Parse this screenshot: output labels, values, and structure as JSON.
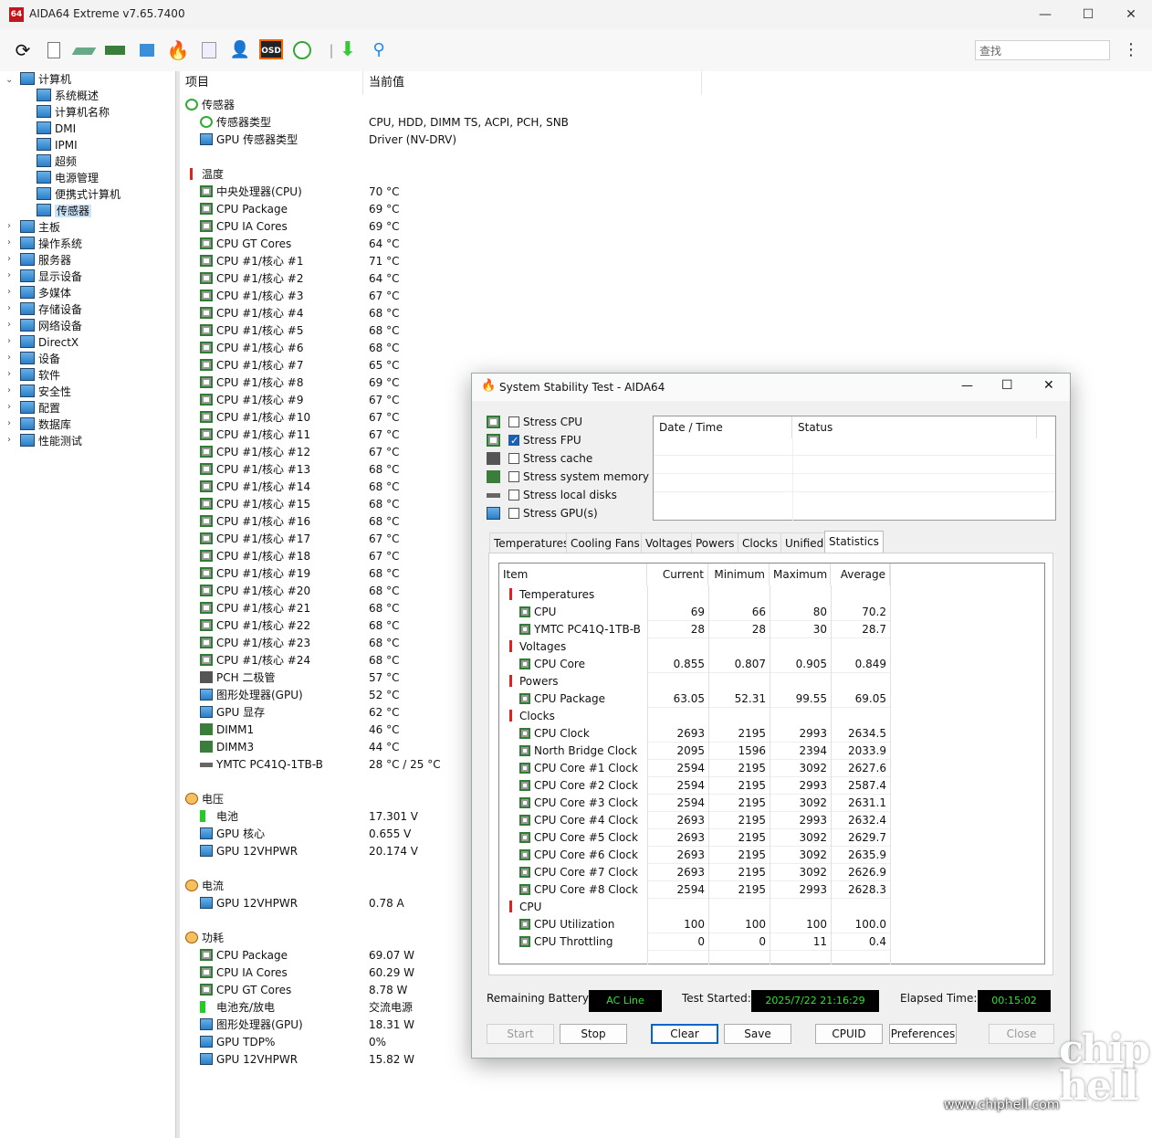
{
  "window": {
    "title": "AIDA64 Extreme v7.65.7400",
    "icon_label": "64",
    "min": "—",
    "max": "☐",
    "close": "✕"
  },
  "toolbar": {
    "osd_label": "OSD",
    "search_placeholder": "查找",
    "kebab": "⋮"
  },
  "tree": {
    "root": "计算机",
    "children": [
      "系统概述",
      "计算机名称",
      "DMI",
      "IPMI",
      "超频",
      "电源管理",
      "便携式计算机",
      "传感器"
    ],
    "sections": [
      "主板",
      "操作系统",
      "服务器",
      "显示设备",
      "多媒体",
      "存储设备",
      "网络设备",
      "DirectX",
      "设备",
      "软件",
      "安全性",
      "配置",
      "数据库",
      "性能测试"
    ]
  },
  "list": {
    "col_item": "项目",
    "col_value": "当前值",
    "sensors": {
      "title": "传感器",
      "rows": [
        [
          "传感器类型",
          "CPU, HDD, DIMM TS, ACPI, PCH, SNB"
        ],
        [
          "GPU 传感器类型",
          "Driver  (NV-DRV)"
        ]
      ]
    },
    "temps": {
      "title": "温度",
      "rows": [
        [
          "中央处理器(CPU)",
          "70 °C"
        ],
        [
          "CPU Package",
          "69 °C"
        ],
        [
          "CPU IA Cores",
          "69 °C"
        ],
        [
          "CPU GT Cores",
          "64 °C"
        ],
        [
          "CPU #1/核心 #1",
          "71 °C"
        ],
        [
          "CPU #1/核心 #2",
          "64 °C"
        ],
        [
          "CPU #1/核心 #3",
          "67 °C"
        ],
        [
          "CPU #1/核心 #4",
          "68 °C"
        ],
        [
          "CPU #1/核心 #5",
          "68 °C"
        ],
        [
          "CPU #1/核心 #6",
          "68 °C"
        ],
        [
          "CPU #1/核心 #7",
          "65 °C"
        ],
        [
          "CPU #1/核心 #8",
          "69 °C"
        ],
        [
          "CPU #1/核心 #9",
          "67 °C"
        ],
        [
          "CPU #1/核心 #10",
          "67 °C"
        ],
        [
          "CPU #1/核心 #11",
          "67 °C"
        ],
        [
          "CPU #1/核心 #12",
          "67 °C"
        ],
        [
          "CPU #1/核心 #13",
          "68 °C"
        ],
        [
          "CPU #1/核心 #14",
          "68 °C"
        ],
        [
          "CPU #1/核心 #15",
          "68 °C"
        ],
        [
          "CPU #1/核心 #16",
          "68 °C"
        ],
        [
          "CPU #1/核心 #17",
          "67 °C"
        ],
        [
          "CPU #1/核心 #18",
          "67 °C"
        ],
        [
          "CPU #1/核心 #19",
          "68 °C"
        ],
        [
          "CPU #1/核心 #20",
          "68 °C"
        ],
        [
          "CPU #1/核心 #21",
          "68 °C"
        ],
        [
          "CPU #1/核心 #22",
          "68 °C"
        ],
        [
          "CPU #1/核心 #23",
          "68 °C"
        ],
        [
          "CPU #1/核心 #24",
          "68 °C"
        ],
        [
          "PCH 二极管",
          "57 °C"
        ],
        [
          "图形处理器(GPU)",
          "52 °C"
        ],
        [
          "GPU 显存",
          "62 °C"
        ],
        [
          "DIMM1",
          "46 °C"
        ],
        [
          "DIMM3",
          "44 °C"
        ],
        [
          "YMTC PC41Q-1TB-B",
          "28 °C / 25 °C"
        ]
      ]
    },
    "volt": {
      "title": "电压",
      "rows": [
        [
          "电池",
          "17.301 V"
        ],
        [
          "GPU 核心",
          "0.655 V"
        ],
        [
          "GPU 12VHPWR",
          "20.174 V"
        ]
      ]
    },
    "curr": {
      "title": "电流",
      "rows": [
        [
          "GPU 12VHPWR",
          "0.78 A"
        ]
      ]
    },
    "power": {
      "title": "功耗",
      "rows": [
        [
          "CPU Package",
          "69.07 W"
        ],
        [
          "CPU IA Cores",
          "60.29 W"
        ],
        [
          "CPU GT Cores",
          "8.78 W"
        ],
        [
          "电池充/放电",
          "交流电源"
        ],
        [
          "图形处理器(GPU)",
          "18.31 W"
        ],
        [
          "GPU TDP%",
          "0%"
        ],
        [
          "GPU 12VHPWR",
          "15.82 W"
        ]
      ]
    }
  },
  "dialog": {
    "title": "System Stability Test - AIDA64",
    "stress": [
      {
        "label": "Stress CPU",
        "checked": false
      },
      {
        "label": "Stress FPU",
        "checked": true
      },
      {
        "label": "Stress cache",
        "checked": false
      },
      {
        "label": "Stress system memory",
        "checked": false
      },
      {
        "label": "Stress local disks",
        "checked": false
      },
      {
        "label": "Stress GPU(s)",
        "checked": false
      }
    ],
    "log_cols": [
      "Date / Time",
      "Status"
    ],
    "tabs": [
      "Temperatures",
      "Cooling Fans",
      "Voltages",
      "Powers",
      "Clocks",
      "Unified",
      "Statistics"
    ],
    "active_tab": "Statistics",
    "stats_cols": [
      "Item",
      "Current",
      "Minimum",
      "Maximum",
      "Average"
    ],
    "stats": [
      {
        "group": "Temperatures"
      },
      {
        "name": "CPU",
        "v": [
          "69",
          "66",
          "80",
          "70.2"
        ]
      },
      {
        "name": "YMTC PC41Q-1TB-B",
        "v": [
          "28",
          "28",
          "30",
          "28.7"
        ]
      },
      {
        "group": "Voltages"
      },
      {
        "name": "CPU Core",
        "v": [
          "0.855",
          "0.807",
          "0.905",
          "0.849"
        ]
      },
      {
        "group": "Powers"
      },
      {
        "name": "CPU Package",
        "v": [
          "63.05",
          "52.31",
          "99.55",
          "69.05"
        ]
      },
      {
        "group": "Clocks"
      },
      {
        "name": "CPU Clock",
        "v": [
          "2693",
          "2195",
          "2993",
          "2634.5"
        ]
      },
      {
        "name": "North Bridge Clock",
        "v": [
          "2095",
          "1596",
          "2394",
          "2033.9"
        ]
      },
      {
        "name": "CPU Core #1 Clock",
        "v": [
          "2594",
          "2195",
          "3092",
          "2627.6"
        ]
      },
      {
        "name": "CPU Core #2 Clock",
        "v": [
          "2594",
          "2195",
          "2993",
          "2587.4"
        ]
      },
      {
        "name": "CPU Core #3 Clock",
        "v": [
          "2594",
          "2195",
          "3092",
          "2631.1"
        ]
      },
      {
        "name": "CPU Core #4 Clock",
        "v": [
          "2693",
          "2195",
          "2993",
          "2632.4"
        ]
      },
      {
        "name": "CPU Core #5 Clock",
        "v": [
          "2693",
          "2195",
          "3092",
          "2629.7"
        ]
      },
      {
        "name": "CPU Core #6 Clock",
        "v": [
          "2693",
          "2195",
          "3092",
          "2635.9"
        ]
      },
      {
        "name": "CPU Core #7 Clock",
        "v": [
          "2693",
          "2195",
          "3092",
          "2626.9"
        ]
      },
      {
        "name": "CPU Core #8 Clock",
        "v": [
          "2594",
          "2195",
          "2993",
          "2628.3"
        ]
      },
      {
        "group": "CPU"
      },
      {
        "name": "CPU Utilization",
        "v": [
          "100",
          "100",
          "100",
          "100.0"
        ]
      },
      {
        "name": "CPU Throttling",
        "v": [
          "0",
          "0",
          "11",
          "0.4"
        ]
      }
    ],
    "status": {
      "battery_label": "Remaining Battery:",
      "battery": "AC Line",
      "started_label": "Test Started:",
      "started": "2025/7/22 21:16:29",
      "elapsed_label": "Elapsed Time:",
      "elapsed": "00:15:02"
    },
    "buttons": {
      "start": "Start",
      "stop": "Stop",
      "clear": "Clear",
      "save": "Save",
      "cpuid": "CPUID",
      "prefs": "Preferences",
      "close": "Close"
    }
  },
  "watermark": {
    "url": "www.chiphell.com",
    "logo": "chip hell"
  }
}
